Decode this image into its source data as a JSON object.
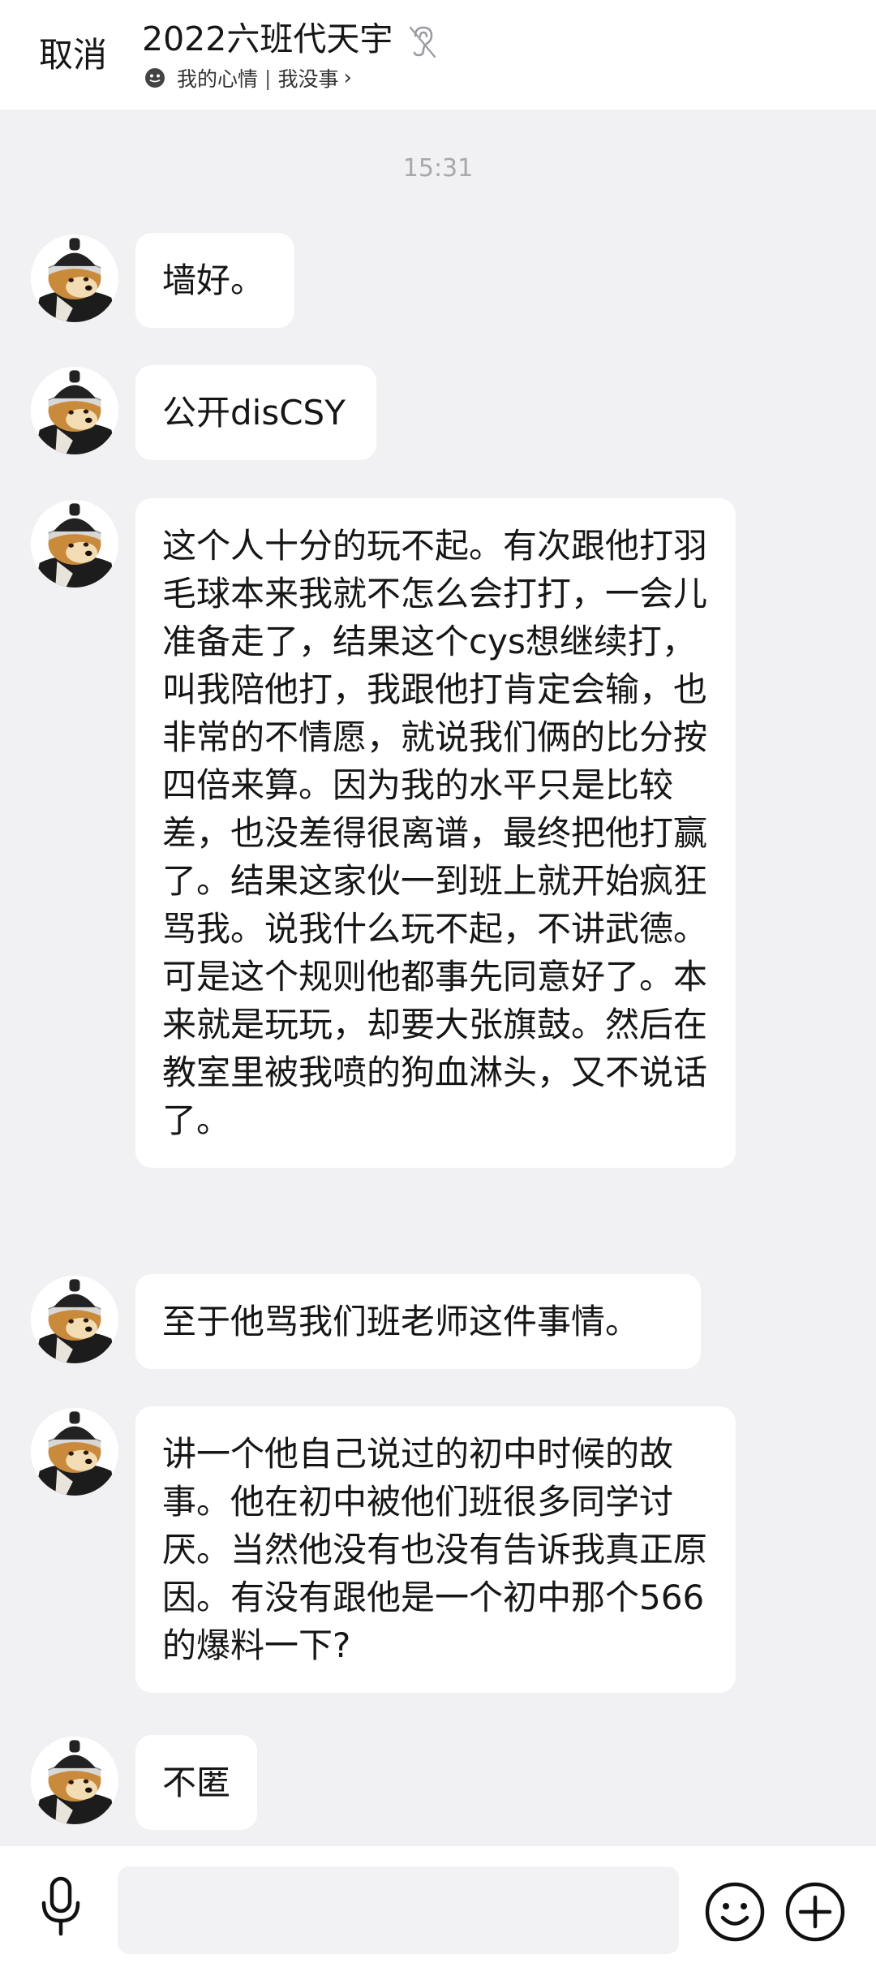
{
  "header": {
    "cancel_label": "取消",
    "title": "2022六班代天宇",
    "status_mood": "我的心情",
    "status_separator": "|",
    "status_text": "我没事",
    "status_chevron": "›"
  },
  "timestamp": "15:31",
  "messages": [
    {
      "text": "墙好。"
    },
    {
      "text": "公开disCSY"
    },
    {
      "text": "这个人十分的玩不起。有次跟他打羽毛球本来我就不怎么会打打，一会儿准备走了，结果这个cys想继续打，叫我陪他打，我跟他打肯定会输，也非常的不情愿，就说我们俩的比分按四倍来算。因为我的水平只是比较差，也没差得很离谱，最终把他打赢了。结果这家伙一到班上就开始疯狂骂我。说我什么玩不起，不讲武德。可是这个规则他都事先同意好了。本来就是玩玩，却要大张旗鼓。然后在教室里被我喷的狗血淋头，又不说话了。"
    },
    {
      "text": "至于他骂我们班老师这件事情。"
    },
    {
      "text": "讲一个他自己说过的初中时候的故事。他在初中被他们班很多同学讨厌。当然他没有也没有告诉我真正原因。有没有跟他是一个初中那个566的爆料一下?"
    },
    {
      "text": "不匿"
    }
  ],
  "input": {
    "placeholder": ""
  },
  "icons": {
    "ear": "ear-icon",
    "mood": "mood-face-icon",
    "avatar": "shiba-dog-avatar",
    "mic": "microphone-icon",
    "emoji": "emoji-icon",
    "plus": "plus-icon"
  },
  "colors": {
    "background": "#f1f1f4",
    "bubble": "#ffffff",
    "timestamp": "#a7a7ad"
  }
}
